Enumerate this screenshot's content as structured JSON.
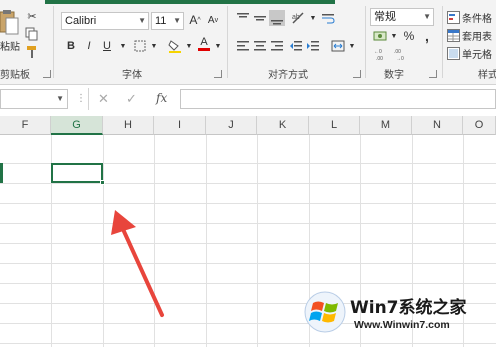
{
  "ribbon": {
    "clipboard": {
      "paste_label": "粘贴",
      "group_label": "剪贴板"
    },
    "font": {
      "font_name": "Calibri",
      "font_size": "11",
      "group_label": "字体",
      "grow_label": "A",
      "shrink_label": "A",
      "bold": "B",
      "italic": "I",
      "underline": "U",
      "font_color_label": "A"
    },
    "alignment": {
      "group_label": "对齐方式"
    },
    "number": {
      "format": "常规",
      "percent": "%",
      "group_label": "数字",
      "comma": ","
    },
    "styles": {
      "conditional": "条件格",
      "table": "套用表",
      "cell": "单元格",
      "group_label": "样式"
    }
  },
  "formula_bar": {
    "name_box": "",
    "fx": "fx",
    "cancel": "✕",
    "enter": "✓"
  },
  "sheet": {
    "columns": [
      "F",
      "G",
      "H",
      "I",
      "J",
      "K",
      "L",
      "M",
      "N",
      "O"
    ],
    "selected_column": "G"
  },
  "watermark": {
    "brand": "Win7系统之家",
    "url": "Www.Winwin7.com"
  },
  "colors": {
    "accent": "#217346",
    "arrow": "#e8453c"
  }
}
